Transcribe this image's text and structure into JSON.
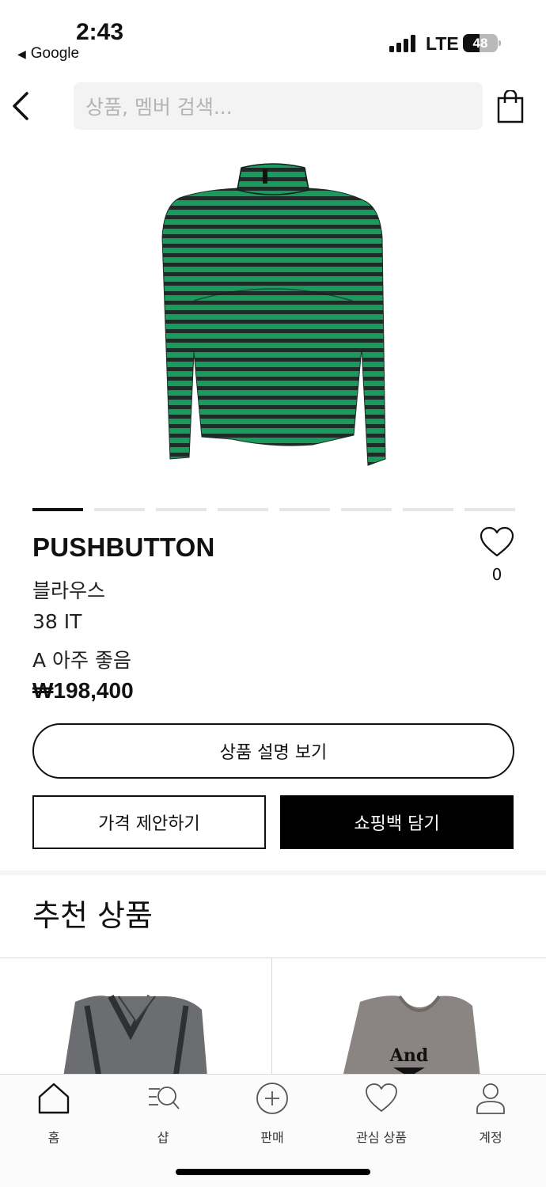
{
  "status_bar": {
    "time": "2:43",
    "back_app": "Google",
    "network": "LTE",
    "battery": "48",
    "battery_level": 0.48
  },
  "header": {
    "search_placeholder": "상품, 멤버 검색..."
  },
  "carousel": {
    "count": 8,
    "active_index": 0
  },
  "product": {
    "brand": "PUSHBUTTON",
    "category": "블라우스",
    "size": "38 IT",
    "condition": "A 아주 좋음",
    "price": "₩198,400",
    "like_count": "0",
    "image_colors": {
      "green": "#1a9a5c",
      "stripe": "#1c2b25"
    }
  },
  "actions": {
    "description_button": "상품 설명 보기",
    "offer_button": "가격 제안하기",
    "cart_button": "쇼핑백 담기"
  },
  "recommended": {
    "title": "추천 상품",
    "items": [
      {
        "image_alt": "sheer-dark-shirt",
        "color": "#5b5d60"
      },
      {
        "image_alt": "grey-sweatshirt",
        "color": "#8a8582",
        "print": "And"
      }
    ]
  },
  "tabbar": {
    "items": [
      {
        "label": "홈",
        "icon": "home-icon"
      },
      {
        "label": "샵",
        "icon": "shop-search-icon"
      },
      {
        "label": "판매",
        "icon": "plus-circle-icon"
      },
      {
        "label": "관심 상품",
        "icon": "heart-icon"
      },
      {
        "label": "계정",
        "icon": "person-icon"
      }
    ]
  }
}
